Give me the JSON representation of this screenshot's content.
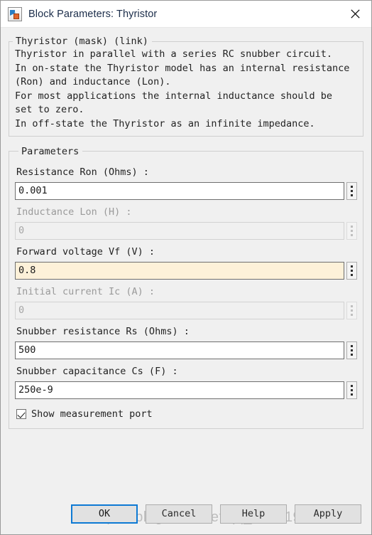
{
  "window": {
    "title": "Block Parameters: Thyristor",
    "icon": "simulink-block-icon",
    "close_label": "✕"
  },
  "description": {
    "legend": "Thyristor (mask) (link)",
    "text": "Thyristor in parallel with a series RC snubber circuit.\nIn on-state the Thyristor model has an internal resistance\n(Ron) and inductance (Lon).\nFor most applications the internal inductance should be\nset to zero.\nIn off-state the Thyristor as an infinite impedance."
  },
  "parameters": {
    "legend": "Parameters",
    "fields": [
      {
        "label": "Resistance Ron (Ohms) :",
        "value": "0.001",
        "state": "enabled",
        "modified": false
      },
      {
        "label": "Inductance Lon (H) :",
        "value": "0",
        "state": "disabled",
        "modified": false
      },
      {
        "label": "Forward voltage Vf (V) :",
        "value": "0.8",
        "state": "enabled",
        "modified": true
      },
      {
        "label": "Initial current Ic (A) :",
        "value": "0",
        "state": "disabled",
        "modified": false
      },
      {
        "label": "Snubber resistance Rs (Ohms) :",
        "value": "500",
        "state": "enabled",
        "modified": false
      },
      {
        "label": "Snubber capacitance Cs (F) :",
        "value": "250e-9",
        "state": "enabled",
        "modified": false
      }
    ],
    "checkbox": {
      "label": "Show measurement port",
      "checked": true
    }
  },
  "footer": {
    "ok_label": "OK",
    "cancel_label": "Cancel",
    "help_label": "Help",
    "apply_label": "Apply",
    "watermark": "https://blog.csdn.net/qq_33851926"
  },
  "colors": {
    "accent": "#0e7ad4",
    "modified_field": "#fdf1d9",
    "dialog_bg": "#f0f0f0",
    "title_text": "#1b2d4a"
  }
}
